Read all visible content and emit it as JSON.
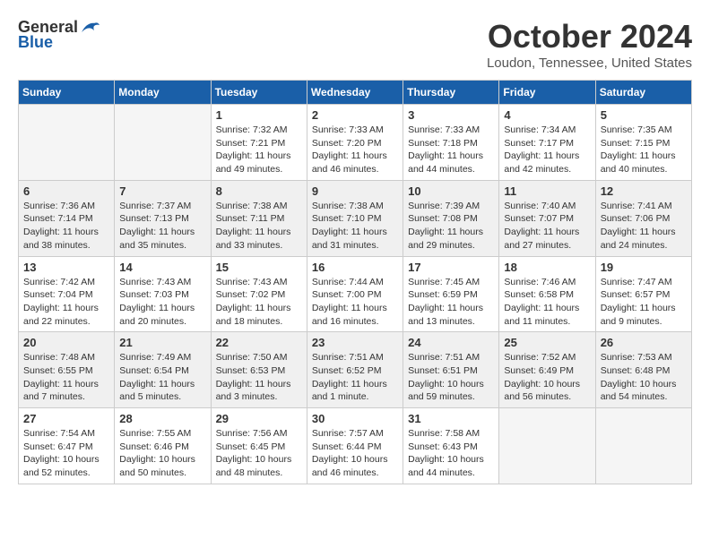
{
  "logo": {
    "general": "General",
    "blue": "Blue"
  },
  "title": "October 2024",
  "location": "Loudon, Tennessee, United States",
  "days_of_week": [
    "Sunday",
    "Monday",
    "Tuesday",
    "Wednesday",
    "Thursday",
    "Friday",
    "Saturday"
  ],
  "weeks": [
    [
      {
        "day": "",
        "sunrise": "",
        "sunset": "",
        "daylight": ""
      },
      {
        "day": "",
        "sunrise": "",
        "sunset": "",
        "daylight": ""
      },
      {
        "day": "1",
        "sunrise": "Sunrise: 7:32 AM",
        "sunset": "Sunset: 7:21 PM",
        "daylight": "Daylight: 11 hours and 49 minutes."
      },
      {
        "day": "2",
        "sunrise": "Sunrise: 7:33 AM",
        "sunset": "Sunset: 7:20 PM",
        "daylight": "Daylight: 11 hours and 46 minutes."
      },
      {
        "day": "3",
        "sunrise": "Sunrise: 7:33 AM",
        "sunset": "Sunset: 7:18 PM",
        "daylight": "Daylight: 11 hours and 44 minutes."
      },
      {
        "day": "4",
        "sunrise": "Sunrise: 7:34 AM",
        "sunset": "Sunset: 7:17 PM",
        "daylight": "Daylight: 11 hours and 42 minutes."
      },
      {
        "day": "5",
        "sunrise": "Sunrise: 7:35 AM",
        "sunset": "Sunset: 7:15 PM",
        "daylight": "Daylight: 11 hours and 40 minutes."
      }
    ],
    [
      {
        "day": "6",
        "sunrise": "Sunrise: 7:36 AM",
        "sunset": "Sunset: 7:14 PM",
        "daylight": "Daylight: 11 hours and 38 minutes."
      },
      {
        "day": "7",
        "sunrise": "Sunrise: 7:37 AM",
        "sunset": "Sunset: 7:13 PM",
        "daylight": "Daylight: 11 hours and 35 minutes."
      },
      {
        "day": "8",
        "sunrise": "Sunrise: 7:38 AM",
        "sunset": "Sunset: 7:11 PM",
        "daylight": "Daylight: 11 hours and 33 minutes."
      },
      {
        "day": "9",
        "sunrise": "Sunrise: 7:38 AM",
        "sunset": "Sunset: 7:10 PM",
        "daylight": "Daylight: 11 hours and 31 minutes."
      },
      {
        "day": "10",
        "sunrise": "Sunrise: 7:39 AM",
        "sunset": "Sunset: 7:08 PM",
        "daylight": "Daylight: 11 hours and 29 minutes."
      },
      {
        "day": "11",
        "sunrise": "Sunrise: 7:40 AM",
        "sunset": "Sunset: 7:07 PM",
        "daylight": "Daylight: 11 hours and 27 minutes."
      },
      {
        "day": "12",
        "sunrise": "Sunrise: 7:41 AM",
        "sunset": "Sunset: 7:06 PM",
        "daylight": "Daylight: 11 hours and 24 minutes."
      }
    ],
    [
      {
        "day": "13",
        "sunrise": "Sunrise: 7:42 AM",
        "sunset": "Sunset: 7:04 PM",
        "daylight": "Daylight: 11 hours and 22 minutes."
      },
      {
        "day": "14",
        "sunrise": "Sunrise: 7:43 AM",
        "sunset": "Sunset: 7:03 PM",
        "daylight": "Daylight: 11 hours and 20 minutes."
      },
      {
        "day": "15",
        "sunrise": "Sunrise: 7:43 AM",
        "sunset": "Sunset: 7:02 PM",
        "daylight": "Daylight: 11 hours and 18 minutes."
      },
      {
        "day": "16",
        "sunrise": "Sunrise: 7:44 AM",
        "sunset": "Sunset: 7:00 PM",
        "daylight": "Daylight: 11 hours and 16 minutes."
      },
      {
        "day": "17",
        "sunrise": "Sunrise: 7:45 AM",
        "sunset": "Sunset: 6:59 PM",
        "daylight": "Daylight: 11 hours and 13 minutes."
      },
      {
        "day": "18",
        "sunrise": "Sunrise: 7:46 AM",
        "sunset": "Sunset: 6:58 PM",
        "daylight": "Daylight: 11 hours and 11 minutes."
      },
      {
        "day": "19",
        "sunrise": "Sunrise: 7:47 AM",
        "sunset": "Sunset: 6:57 PM",
        "daylight": "Daylight: 11 hours and 9 minutes."
      }
    ],
    [
      {
        "day": "20",
        "sunrise": "Sunrise: 7:48 AM",
        "sunset": "Sunset: 6:55 PM",
        "daylight": "Daylight: 11 hours and 7 minutes."
      },
      {
        "day": "21",
        "sunrise": "Sunrise: 7:49 AM",
        "sunset": "Sunset: 6:54 PM",
        "daylight": "Daylight: 11 hours and 5 minutes."
      },
      {
        "day": "22",
        "sunrise": "Sunrise: 7:50 AM",
        "sunset": "Sunset: 6:53 PM",
        "daylight": "Daylight: 11 hours and 3 minutes."
      },
      {
        "day": "23",
        "sunrise": "Sunrise: 7:51 AM",
        "sunset": "Sunset: 6:52 PM",
        "daylight": "Daylight: 11 hours and 1 minute."
      },
      {
        "day": "24",
        "sunrise": "Sunrise: 7:51 AM",
        "sunset": "Sunset: 6:51 PM",
        "daylight": "Daylight: 10 hours and 59 minutes."
      },
      {
        "day": "25",
        "sunrise": "Sunrise: 7:52 AM",
        "sunset": "Sunset: 6:49 PM",
        "daylight": "Daylight: 10 hours and 56 minutes."
      },
      {
        "day": "26",
        "sunrise": "Sunrise: 7:53 AM",
        "sunset": "Sunset: 6:48 PM",
        "daylight": "Daylight: 10 hours and 54 minutes."
      }
    ],
    [
      {
        "day": "27",
        "sunrise": "Sunrise: 7:54 AM",
        "sunset": "Sunset: 6:47 PM",
        "daylight": "Daylight: 10 hours and 52 minutes."
      },
      {
        "day": "28",
        "sunrise": "Sunrise: 7:55 AM",
        "sunset": "Sunset: 6:46 PM",
        "daylight": "Daylight: 10 hours and 50 minutes."
      },
      {
        "day": "29",
        "sunrise": "Sunrise: 7:56 AM",
        "sunset": "Sunset: 6:45 PM",
        "daylight": "Daylight: 10 hours and 48 minutes."
      },
      {
        "day": "30",
        "sunrise": "Sunrise: 7:57 AM",
        "sunset": "Sunset: 6:44 PM",
        "daylight": "Daylight: 10 hours and 46 minutes."
      },
      {
        "day": "31",
        "sunrise": "Sunrise: 7:58 AM",
        "sunset": "Sunset: 6:43 PM",
        "daylight": "Daylight: 10 hours and 44 minutes."
      },
      {
        "day": "",
        "sunrise": "",
        "sunset": "",
        "daylight": ""
      },
      {
        "day": "",
        "sunrise": "",
        "sunset": "",
        "daylight": ""
      }
    ]
  ]
}
